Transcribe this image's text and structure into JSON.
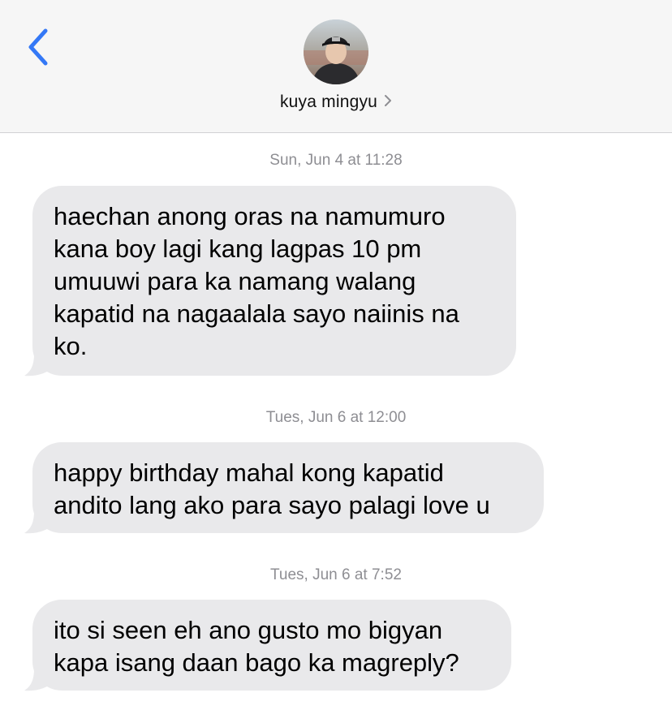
{
  "header": {
    "back_icon": "chevron-left-icon",
    "avatar_icon": "contact-avatar-photo",
    "contact_name": "kuya mingyu",
    "name_chevron_icon": "chevron-right-icon"
  },
  "colors": {
    "accent": "#3478f6",
    "header_bg": "#f6f6f6",
    "bubble_bg": "#e9e9eb",
    "timestamp": "#8e8e93"
  },
  "thread": [
    {
      "timestamp": "Sun, Jun 4 at 11:28",
      "message": "haechan anong oras na namumuro\nkana boy lagi kang lagpas 10 pm\numuuwi para ka namang walang\nkapatid na nagaalala sayo naiinis na\nko."
    },
    {
      "timestamp": "Tues, Jun 6 at 12:00",
      "message": "happy birthday mahal kong kapatid\nandito lang ako para sayo palagi love u"
    },
    {
      "timestamp": "Tues, Jun 6 at 7:52",
      "message": "ito si seen eh ano gusto mo bigyan\nkapa isang daan bago ka magreply?"
    }
  ]
}
